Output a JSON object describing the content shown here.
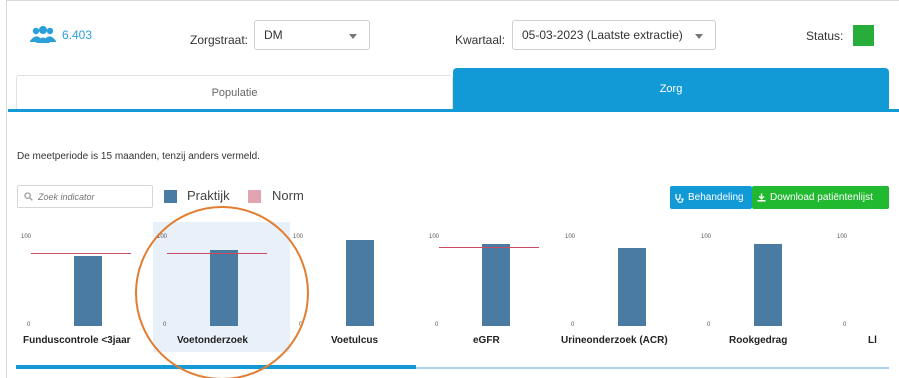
{
  "header": {
    "patient_count": "6.403",
    "zorgstraat_label": "Zorgstraat:",
    "zorgstraat_value": "DM",
    "kwartaal_label": "Kwartaal:",
    "kwartaal_value": "05-03-2023 (Laatste extractie)",
    "status_label": "Status:",
    "status_color": "#27ae3a"
  },
  "tabs": [
    {
      "label": "Populatie",
      "active": false
    },
    {
      "label": "Zorg",
      "active": true
    }
  ],
  "info_text": "De meetperiode is 15 maanden, tenzij anders vermeld.",
  "search": {
    "placeholder": "Zoek indicator"
  },
  "legend": [
    {
      "label": "Praktijk",
      "color": "#4a7ba3"
    },
    {
      "label": "Norm",
      "color": "#e2a4b0"
    }
  ],
  "buttons": {
    "behandeling": "Behandeling",
    "download": "Download patiëntenlijst"
  },
  "chart_data": {
    "type": "bar",
    "categories": [
      "Funduscontrole <3jaar",
      "Voetonderzoek",
      "Voetulcus",
      "eGFR",
      "Urineonderzoek (ACR)",
      "Rookgedrag",
      "Ll"
    ],
    "series": [
      {
        "name": "Praktijk",
        "values": [
          79,
          86,
          98,
          93,
          89,
          93,
          null
        ]
      },
      {
        "name": "Norm",
        "values": [
          83,
          83,
          null,
          90,
          null,
          null,
          null
        ]
      }
    ],
    "ylim": [
      0,
      100
    ],
    "tick_labels": [
      "100",
      "0"
    ],
    "selected_index": 1
  },
  "colors": {
    "accent": "#129ad7",
    "download_green": "#21b92f",
    "bar": "#4a7ba3",
    "norm_line": "#c94a62",
    "highlight_circle": "#e27d31"
  }
}
